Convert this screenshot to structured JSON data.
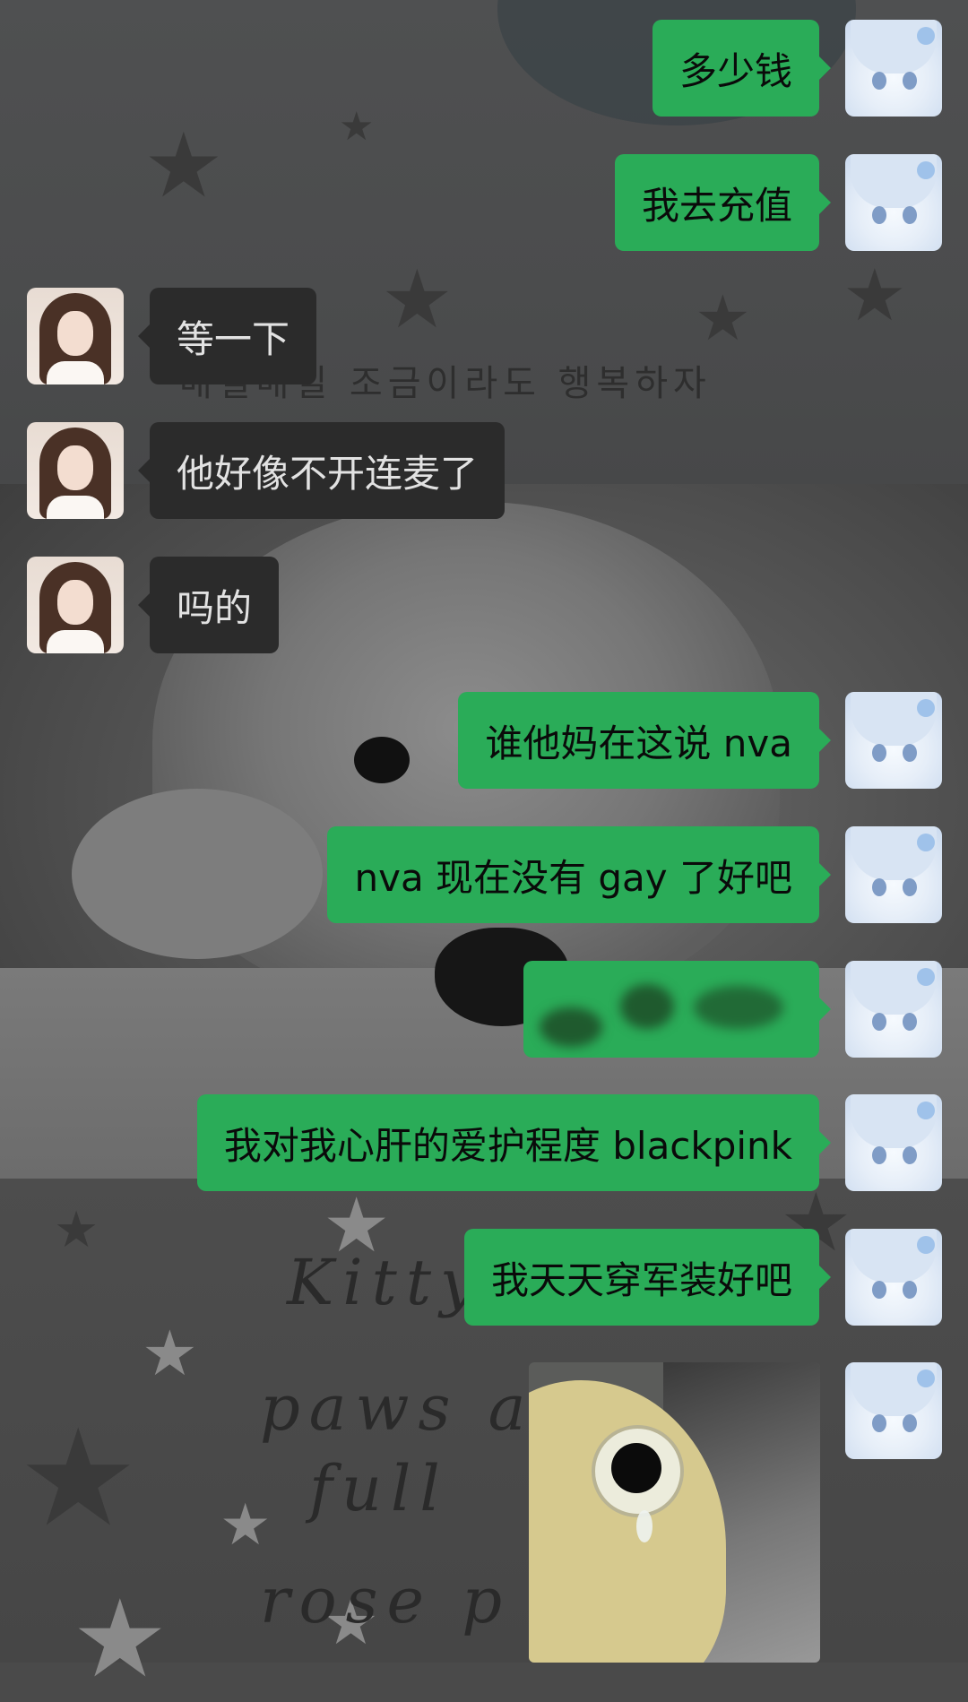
{
  "background": {
    "korean_text": "매일매일 조금이라도 행복하자",
    "scribble_lines": [
      "Kitty",
      "paws a",
      "full",
      "rose p"
    ]
  },
  "colors": {
    "my_bubble": "#2aac58",
    "their_bubble": "#2b2b2b",
    "my_text": "#0a0a0a",
    "their_text": "#e2e2e2"
  },
  "messages": [
    {
      "sender": "me",
      "text": "多少钱"
    },
    {
      "sender": "me",
      "text": "我去充值"
    },
    {
      "sender": "other",
      "text": "等一下"
    },
    {
      "sender": "other",
      "text": "他好像不开连麦了"
    },
    {
      "sender": "other",
      "text": "吗的"
    },
    {
      "sender": "me",
      "text": "谁他妈在这说 nva"
    },
    {
      "sender": "me",
      "text": "nva 现在没有 gay 了好吧"
    },
    {
      "sender": "me",
      "text": "",
      "redacted": true
    },
    {
      "sender": "me",
      "text": "我对我心肝的爱护程度 blackpink"
    },
    {
      "sender": "me",
      "text": "我天天穿军装好吧"
    },
    {
      "sender": "me",
      "type": "image",
      "image": "crying-yellow-plush-sticker"
    }
  ]
}
